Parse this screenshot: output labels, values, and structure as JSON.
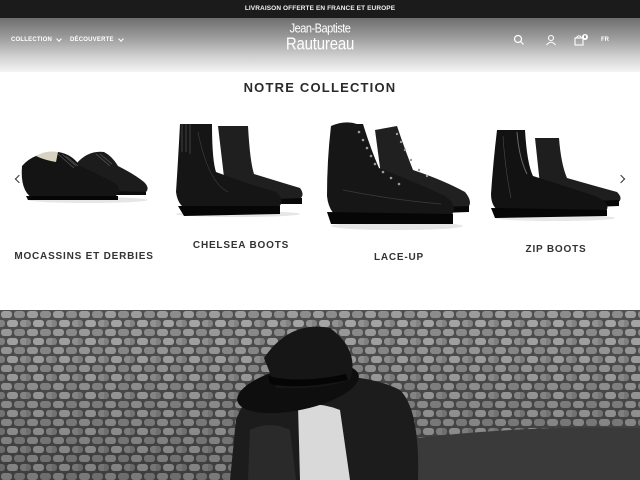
{
  "announcement": "LIVRAISON OFFERTE EN FRANCE ET EUROPE",
  "nav": {
    "collection": "COLLECTION",
    "decouverte": "DÉCOUVERTE"
  },
  "logo": {
    "line1": "Jean-Baptiste",
    "line2": "Rautureau"
  },
  "header_icons": [
    "search-icon",
    "user-icon",
    "bag-icon"
  ],
  "cart_count": "0",
  "language": "FR",
  "collection": {
    "title": "NOTRE COLLECTION",
    "products": [
      {
        "label": "MOCASSINS ET DERBIES"
      },
      {
        "label": "CHELSEA BOOTS"
      },
      {
        "label": "LACE-UP"
      },
      {
        "label": "ZIP BOOTS"
      }
    ]
  }
}
